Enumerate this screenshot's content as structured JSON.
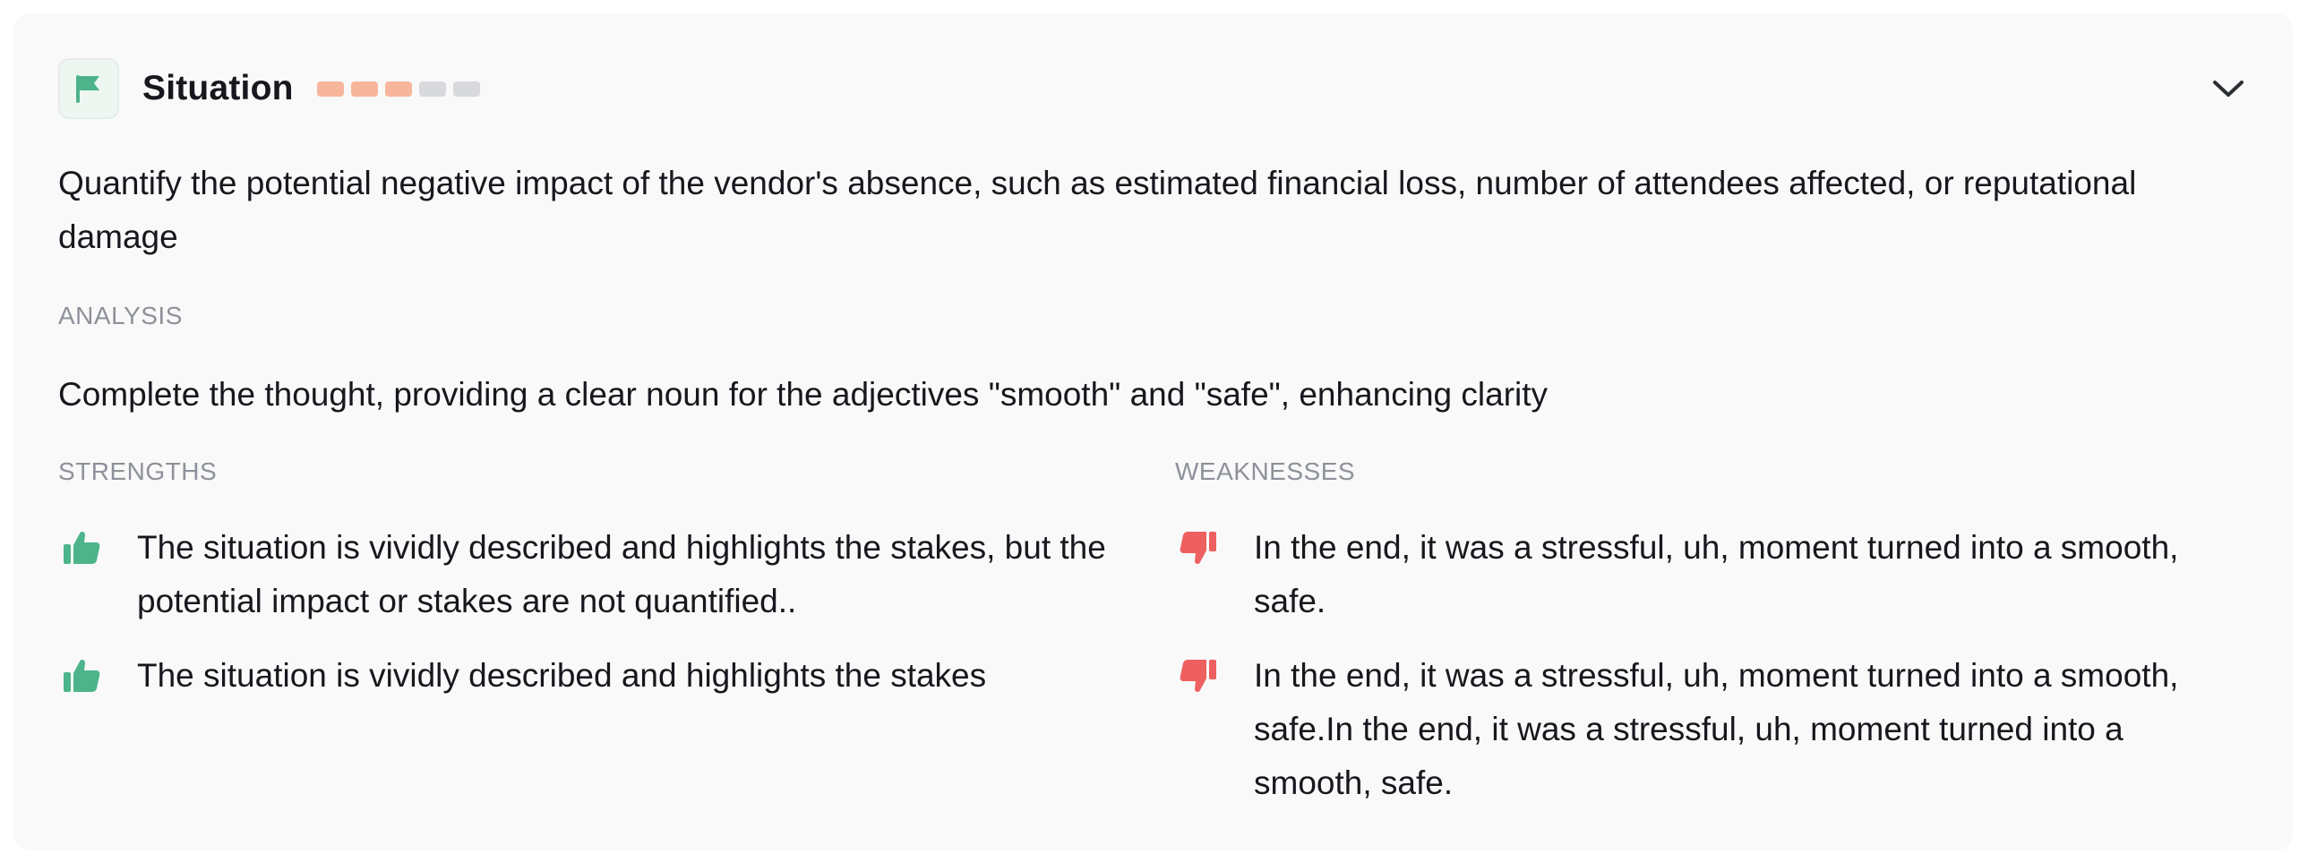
{
  "header": {
    "title": "Situation",
    "rating": {
      "value": 3,
      "max": 5,
      "filled_color": "#f7b69c",
      "empty_color": "#d8d9dc"
    },
    "expand_icon": "chevron-down-icon",
    "section_icon": "flag-icon"
  },
  "situation": {
    "text": "Quantify the potential negative impact of the vendor's absence, such as estimated financial loss, number of attendees affected, or reputational damage"
  },
  "analysis": {
    "label": "ANALYSIS",
    "text": "Complete the thought, providing a clear noun for the adjectives \"smooth\" and \"safe\", enhancing clarity"
  },
  "strengths": {
    "label": "STRENGTHS",
    "icon": "thumbs-up-icon",
    "color": "#4cb38a",
    "items": [
      "The situation is vividly described and highlights the stakes, but the potential impact or stakes are not quantified..",
      "The situation is vividly described and highlights the stakes"
    ]
  },
  "weaknesses": {
    "label": "WEAKNESSES",
    "icon": "thumbs-down-icon",
    "color": "#ee5f5f",
    "items": [
      "In the end, it was a stressful, uh, moment turned into a smooth, safe.",
      "In the end, it was a stressful, uh, moment turned into a smooth, safe.In the end, it was a stressful, uh, moment turned into a smooth, safe."
    ]
  }
}
